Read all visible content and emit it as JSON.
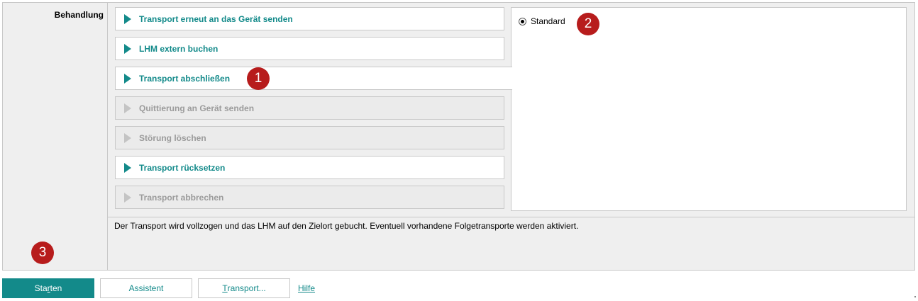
{
  "section": {
    "label": "Behandlung"
  },
  "actions": [
    {
      "label": "Transport erneut an das Gerät senden",
      "enabled": true
    },
    {
      "label": "LHM extern buchen",
      "enabled": true
    },
    {
      "label": "Transport abschließen",
      "enabled": true,
      "selected": true
    },
    {
      "label": "Quittierung an Gerät senden",
      "enabled": false
    },
    {
      "label": "Störung löschen",
      "enabled": false
    },
    {
      "label": "Transport rücksetzen",
      "enabled": true
    },
    {
      "label": "Transport abbrechen",
      "enabled": false
    }
  ],
  "options": {
    "radio_label": "Standard",
    "selected": true
  },
  "description": "Der Transport wird vollzogen und das LHM auf den Zielort gebucht. Eventuell vorhandene Folgetransporte werden aktiviert.",
  "markers": [
    "1",
    "2",
    "3"
  ],
  "footer": {
    "start_pre": "Sta",
    "start_u": "r",
    "start_post": "ten",
    "assistant_label": "Assistent",
    "transport_u": "T",
    "transport_rest": "ransport...",
    "help_label": "Hilfe"
  },
  "colors": {
    "accent": "#138a8a",
    "marker": "#b71c1c",
    "disabled_text": "#9b9b9b"
  }
}
